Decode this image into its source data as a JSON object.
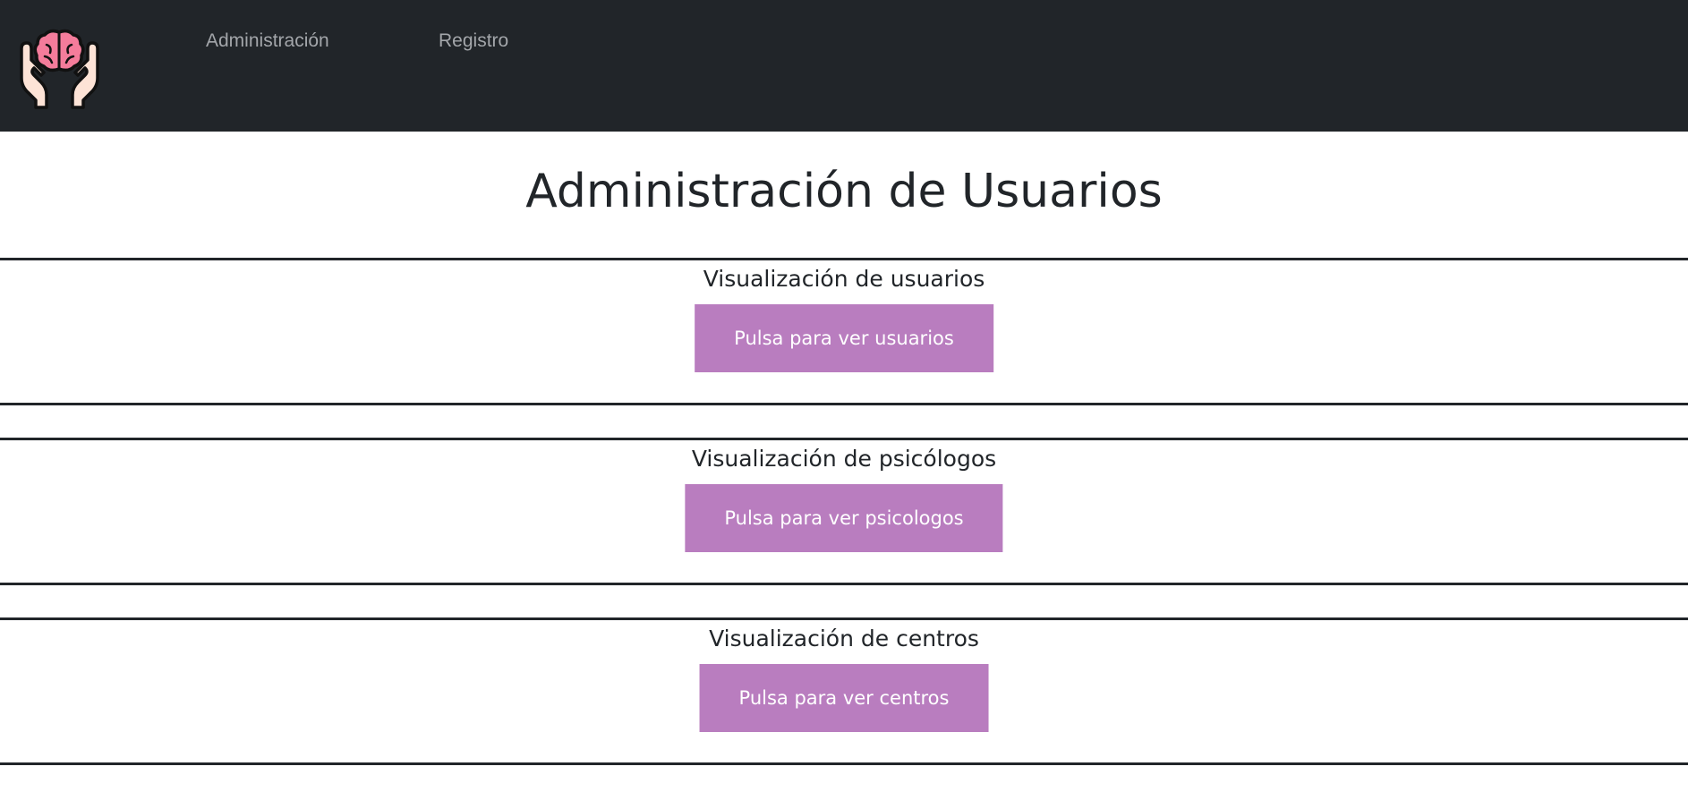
{
  "navbar": {
    "logo_icon": "brain-in-hands-icon",
    "links": [
      {
        "label": "Administración"
      },
      {
        "label": "Registro"
      }
    ]
  },
  "main": {
    "title": "Administración de Usuarios",
    "sections": [
      {
        "heading": "Visualización de usuarios",
        "button_label": "Pulsa para ver usuarios"
      },
      {
        "heading": "Visualización de psicólogos",
        "button_label": "Pulsa para ver psicologos"
      },
      {
        "heading": "Visualización de centros",
        "button_label": "Pulsa para ver centros"
      }
    ]
  },
  "colors": {
    "navbar_bg": "#212529",
    "nav_link": "#a3a6aa",
    "button_bg": "#b97dbf",
    "text": "#212529"
  }
}
